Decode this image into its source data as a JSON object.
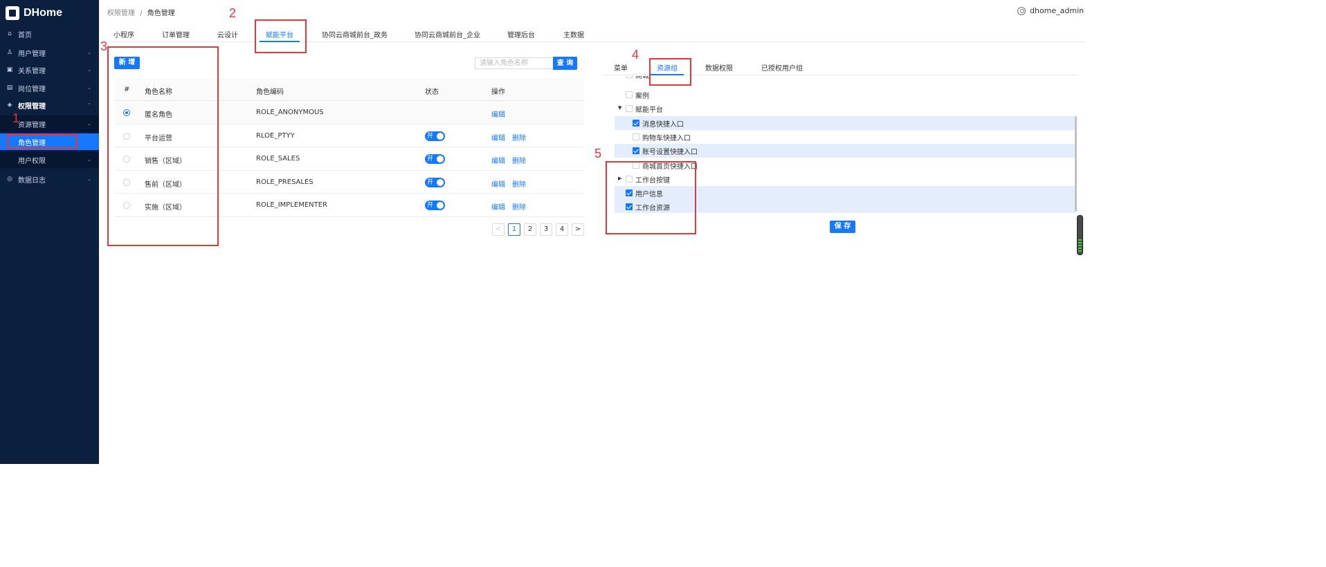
{
  "app": {
    "title": "DHome"
  },
  "sidebar": {
    "items": [
      {
        "label": "首页",
        "icon": "home-icon"
      },
      {
        "label": "用户管理",
        "icon": "user-icon"
      },
      {
        "label": "关系管理",
        "icon": "relation-icon"
      },
      {
        "label": "岗位管理",
        "icon": "post-icon"
      },
      {
        "label": "权限管理",
        "icon": "shield-icon"
      },
      {
        "label": "资源管理"
      },
      {
        "label": "角色管理"
      },
      {
        "label": "用户权限"
      },
      {
        "label": "数据日志",
        "icon": "log-icon"
      }
    ]
  },
  "breadcrumb": {
    "parent": "权限管理",
    "separator": "/",
    "current": "角色管理"
  },
  "user": {
    "name": "dhome_admin"
  },
  "top_tabs": [
    "小程序",
    "订单管理",
    "云设计",
    "赋能平台",
    "协同云商城前台_政务",
    "协同云商城前台_企业",
    "管理后台",
    "主数据"
  ],
  "roles": {
    "new_button": "新 增",
    "search_placeholder": "请输入角色名称",
    "query_button": "查 询",
    "columns": [
      "#",
      "角色名称",
      "角色编码",
      "状态",
      "操作"
    ],
    "rows": [
      {
        "name": "匿名角色",
        "code": "ROLE_ANONYMOUS",
        "selected": true,
        "switch": "",
        "edit": "编辑",
        "delete": ""
      },
      {
        "name": "平台运营",
        "code": "RLOE_PTYY",
        "selected": false,
        "switch": "开",
        "edit": "编辑",
        "delete": "删除"
      },
      {
        "name": "销售（区域）",
        "code": "ROLE_SALES",
        "selected": false,
        "switch": "开",
        "edit": "编辑",
        "delete": "删除"
      },
      {
        "name": "售前（区域）",
        "code": "ROLE_PRESALES",
        "selected": false,
        "switch": "开",
        "edit": "编辑",
        "delete": "删除"
      },
      {
        "name": "实施（区域）",
        "code": "ROLE_IMPLEMENTER",
        "selected": false,
        "switch": "开",
        "edit": "编辑",
        "delete": "删除"
      }
    ],
    "pagination": {
      "prev": "<",
      "pages": [
        "1",
        "2",
        "3",
        "4"
      ],
      "current": "1",
      "next": ">"
    }
  },
  "right_tabs": [
    "菜单",
    "资源组",
    "数据权限",
    "已授权用户组"
  ],
  "resource_tree": [
    {
      "label": "商城",
      "checked": false,
      "highlight": false
    },
    {
      "label": "案例",
      "checked": false,
      "highlight": false
    },
    {
      "label": "赋能平台",
      "checked": false,
      "highlight": false
    },
    {
      "label": "消息快捷入口",
      "checked": true,
      "highlight": true
    },
    {
      "label": "购物车快捷入口",
      "checked": false,
      "highlight": false
    },
    {
      "label": "账号设置快捷入口",
      "checked": true,
      "highlight": true
    },
    {
      "label": "商城首页快捷入口",
      "checked": false,
      "highlight": false
    },
    {
      "label": "工作台按键",
      "checked": false,
      "highlight": false
    },
    {
      "label": "用户信息",
      "checked": true,
      "highlight": true
    },
    {
      "label": "工作台资源",
      "checked": true,
      "highlight": true
    }
  ],
  "save_button": "保 存",
  "annotations": [
    "1",
    "2",
    "3",
    "4",
    "5"
  ],
  "colors": {
    "sidebar_bg": "#0b1f3f",
    "accent": "#1677ff",
    "annotation": "#e8353c"
  }
}
